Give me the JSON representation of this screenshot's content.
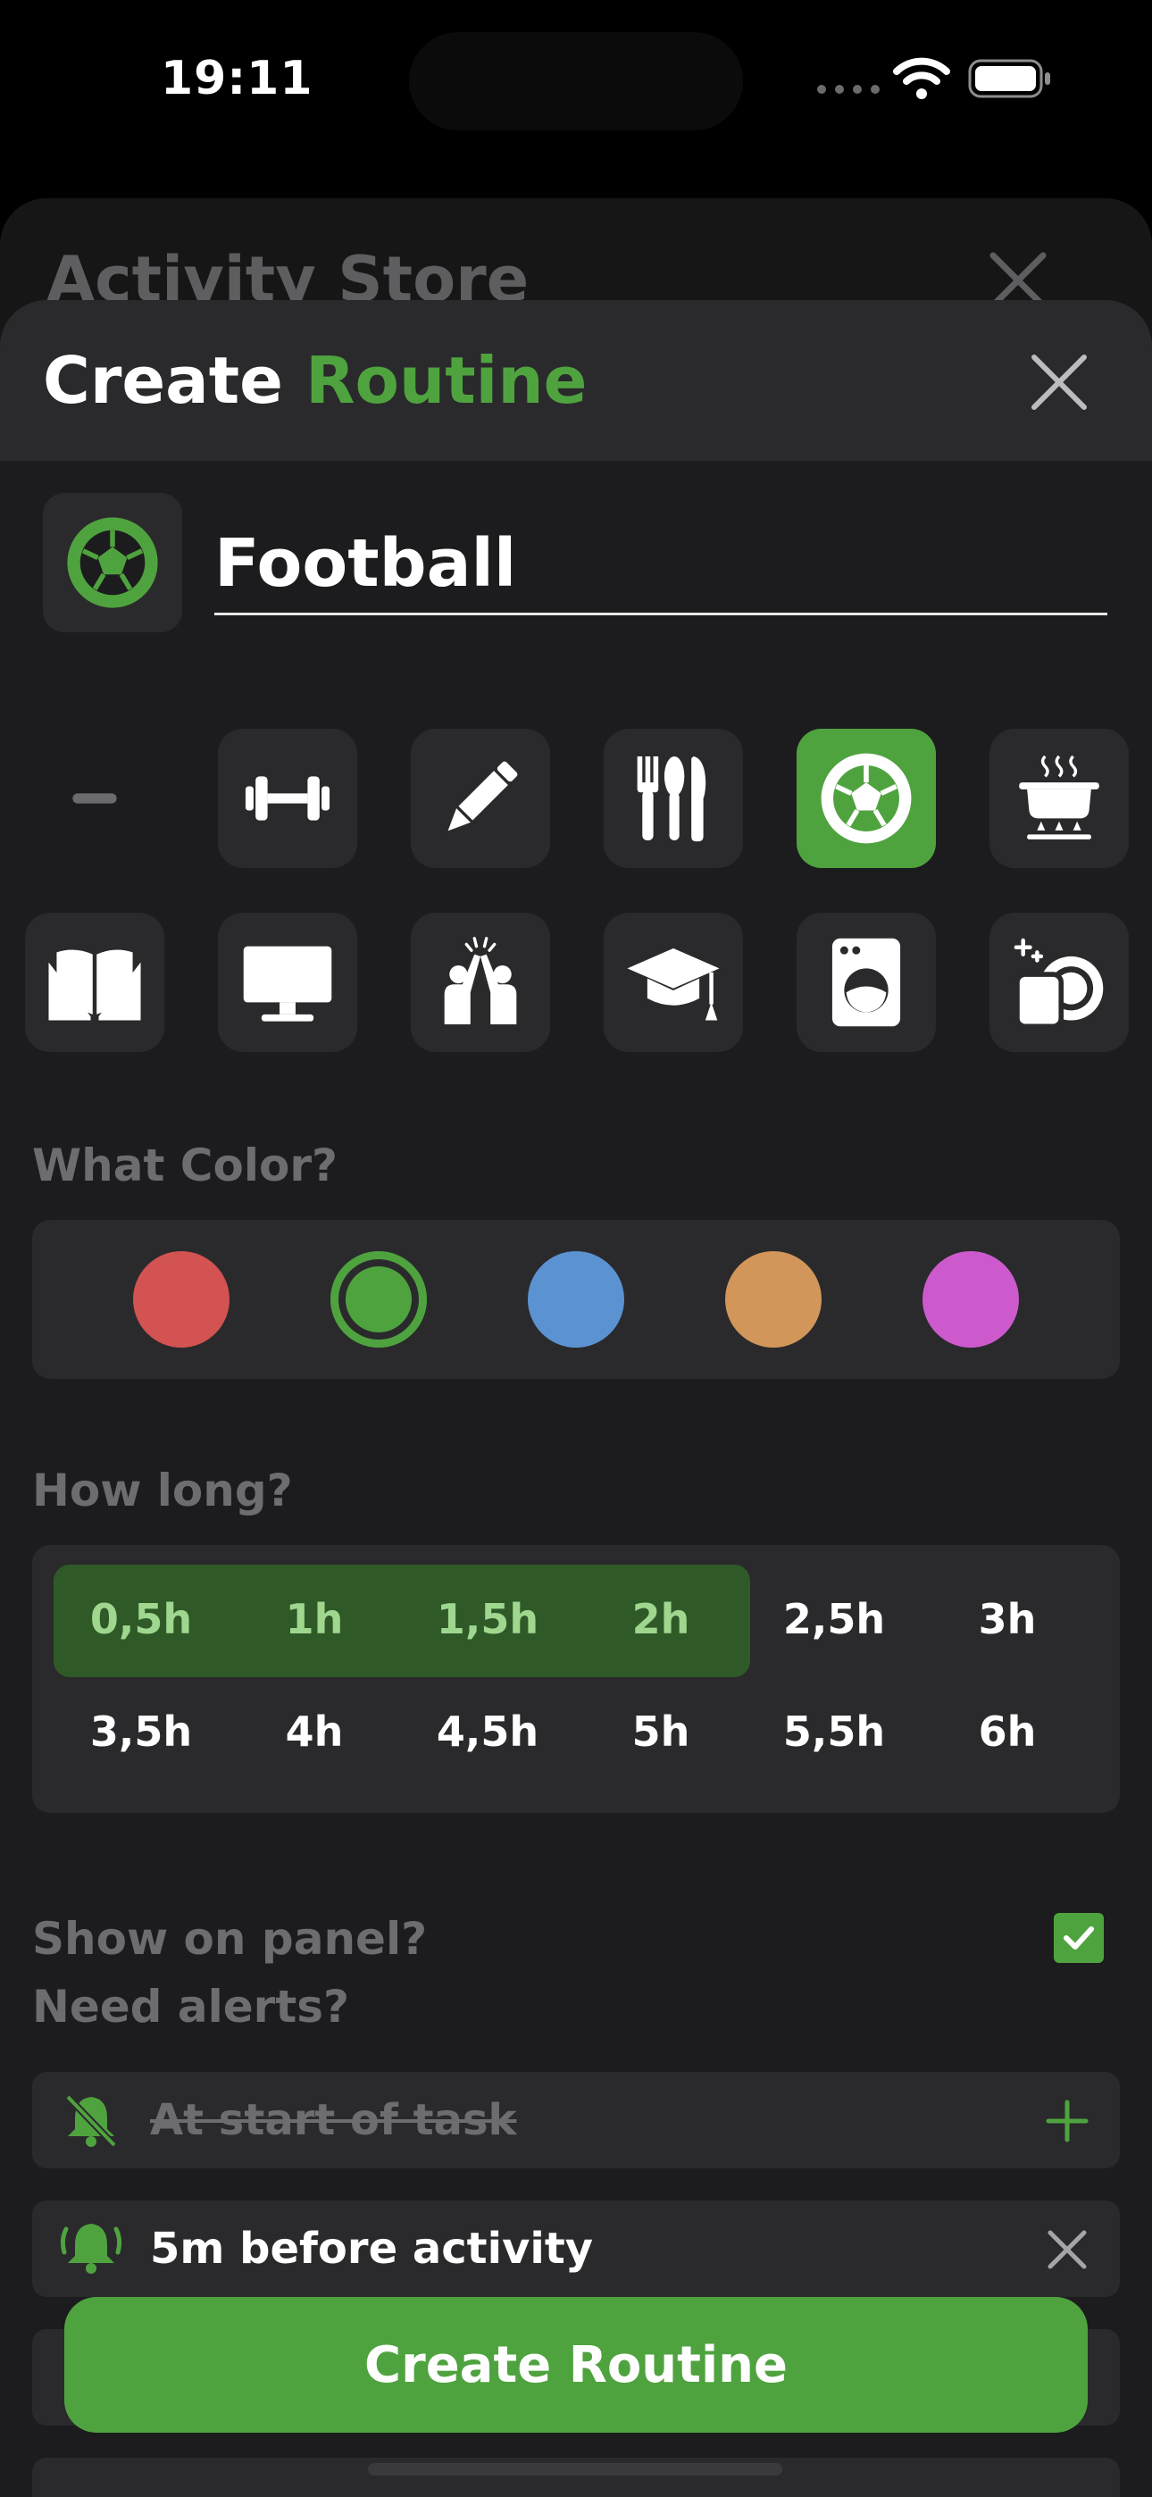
{
  "status_bar": {
    "time": "19:11"
  },
  "background_sheet": {
    "title": "Activity Store"
  },
  "sheet": {
    "title_part1": "Create",
    "title_part2": "Routine"
  },
  "name_field": {
    "value": "Football",
    "icon": "soccer-ball-icon"
  },
  "icons": [
    "none-dash-icon",
    "dumbbell-icon",
    "pencil-icon",
    "cutlery-icon",
    "soccer-ball-icon",
    "cooking-pot-icon",
    "book-icon",
    "monitor-icon",
    "high-five-icon",
    "graduation-cap-icon",
    "washing-machine-icon",
    "dishes-icon"
  ],
  "selected_icon": "soccer-ball-icon",
  "color_section": {
    "label": "What Color?",
    "colors": [
      "#d35252",
      "#4fa33f",
      "#5b93d2",
      "#d2965a",
      "#cd5acd"
    ],
    "selected": "#4fa33f"
  },
  "duration_section": {
    "label": "How long?",
    "options": [
      "0,5h",
      "1h",
      "1,5h",
      "2h",
      "2,5h",
      "3h",
      "3,5h",
      "4h",
      "4,5h",
      "5h",
      "5,5h",
      "6h"
    ],
    "selected_up_to": "2h"
  },
  "panel_section": {
    "label": "Show on panel?",
    "checked": true
  },
  "alerts_section": {
    "label": "Need alerts?",
    "items": [
      {
        "text": "At start of task",
        "active": false
      },
      {
        "text": "5m before activity",
        "active": true
      }
    ]
  },
  "cta": {
    "label": "Create Routine"
  },
  "accent_color": "#4fa33f"
}
